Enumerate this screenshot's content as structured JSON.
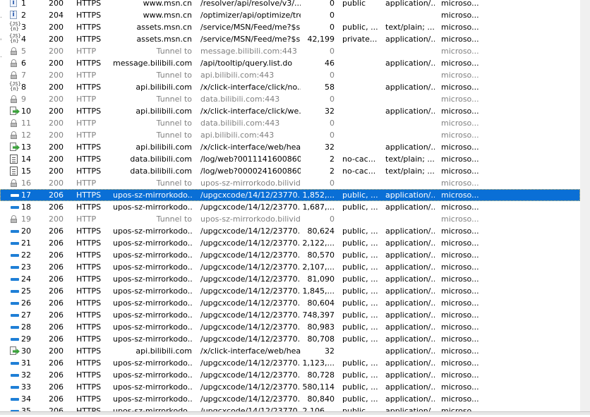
{
  "sessions": [
    {
      "icon": "info-icon",
      "num": "1",
      "result": "200",
      "protocol": "HTTPS",
      "host": "www.msn.cn",
      "url": "/resolver/api/resolve/v3/...",
      "body": "0",
      "caching": "public",
      "content_type": "application/...",
      "process": "microso...",
      "tunnel": false,
      "selected": false
    },
    {
      "icon": "info-icon",
      "num": "2",
      "result": "204",
      "protocol": "HTTPS",
      "host": "www.msn.cn",
      "url": "/optimizer/api/optimize/tre...",
      "body": "0",
      "caching": "",
      "content_type": "",
      "process": "microso...",
      "tunnel": false,
      "selected": false
    },
    {
      "icon": "js-icon",
      "num": "3",
      "result": "200",
      "protocol": "HTTPS",
      "host": "assets.msn.cn",
      "url": "/service/MSN/Feed/me?$s...",
      "body": "0",
      "caching": "public, ...",
      "content_type": "text/plain; ...",
      "process": "microso...",
      "tunnel": false,
      "selected": false
    },
    {
      "icon": "js-icon",
      "num": "4",
      "result": "200",
      "protocol": "HTTPS",
      "host": "assets.msn.cn",
      "url": "/service/MSN/Feed/me?$s...",
      "body": "42,199",
      "caching": "private...",
      "content_type": "application/...",
      "process": "microso...",
      "tunnel": false,
      "selected": false
    },
    {
      "icon": "lock-icon",
      "num": "5",
      "result": "200",
      "protocol": "HTTP",
      "host": "Tunnel to",
      "url": "message.bilibili.com:443",
      "body": "0",
      "caching": "",
      "content_type": "",
      "process": "microso...",
      "tunnel": true,
      "selected": false
    },
    {
      "icon": "lock-icon",
      "num": "6",
      "result": "200",
      "protocol": "HTTPS",
      "host": "message.bilibili.com",
      "url": "/api/tooltip/query.list.do",
      "body": "46",
      "caching": "",
      "content_type": "application/...",
      "process": "microso...",
      "tunnel": false,
      "selected": false
    },
    {
      "icon": "lock-icon",
      "num": "7",
      "result": "200",
      "protocol": "HTTP",
      "host": "Tunnel to",
      "url": "api.bilibili.com:443",
      "body": "0",
      "caching": "",
      "content_type": "",
      "process": "microso...",
      "tunnel": true,
      "selected": false
    },
    {
      "icon": "js-icon",
      "num": "8",
      "result": "200",
      "protocol": "HTTPS",
      "host": "api.bilibili.com",
      "url": "/x/click-interface/click/no...",
      "body": "58",
      "caching": "",
      "content_type": "application/...",
      "process": "microso...",
      "tunnel": false,
      "selected": false
    },
    {
      "icon": "lock-icon",
      "num": "9",
      "result": "200",
      "protocol": "HTTP",
      "host": "Tunnel to",
      "url": "data.bilibili.com:443",
      "body": "0",
      "caching": "",
      "content_type": "",
      "process": "microso...",
      "tunnel": true,
      "selected": false
    },
    {
      "icon": "arrow-icon",
      "num": "10",
      "result": "200",
      "protocol": "HTTPS",
      "host": "api.bilibili.com",
      "url": "/x/click-interface/click/we...",
      "body": "32",
      "caching": "",
      "content_type": "application/...",
      "process": "microso...",
      "tunnel": false,
      "selected": false
    },
    {
      "icon": "lock-icon",
      "num": "11",
      "result": "200",
      "protocol": "HTTP",
      "host": "Tunnel to",
      "url": "data.bilibili.com:443",
      "body": "0",
      "caching": "",
      "content_type": "",
      "process": "microso...",
      "tunnel": true,
      "selected": false
    },
    {
      "icon": "lock-icon",
      "num": "12",
      "result": "200",
      "protocol": "HTTP",
      "host": "Tunnel to",
      "url": "api.bilibili.com:443",
      "body": "0",
      "caching": "",
      "content_type": "",
      "process": "microso...",
      "tunnel": true,
      "selected": false
    },
    {
      "icon": "arrow-icon",
      "num": "13",
      "result": "200",
      "protocol": "HTTPS",
      "host": "api.bilibili.com",
      "url": "/x/click-interface/web/hea...",
      "body": "32",
      "caching": "",
      "content_type": "application/...",
      "process": "microso...",
      "tunnel": false,
      "selected": false
    },
    {
      "icon": "doc-icon",
      "num": "14",
      "result": "200",
      "protocol": "HTTPS",
      "host": "data.bilibili.com",
      "url": "/log/web?0011141600860...",
      "body": "2",
      "caching": "no-cac...",
      "content_type": "text/plain; ...",
      "process": "microso...",
      "tunnel": false,
      "selected": false
    },
    {
      "icon": "doc-icon",
      "num": "15",
      "result": "200",
      "protocol": "HTTPS",
      "host": "data.bilibili.com",
      "url": "/log/web?0000241600860...",
      "body": "2",
      "caching": "no-cac...",
      "content_type": "text/plain; ...",
      "process": "microso...",
      "tunnel": false,
      "selected": false
    },
    {
      "icon": "lock-icon",
      "num": "16",
      "result": "200",
      "protocol": "HTTP",
      "host": "Tunnel to",
      "url": "upos-sz-mirrorkodo.bilivid...",
      "body": "0",
      "caching": "",
      "content_type": "",
      "process": "microso...",
      "tunnel": true,
      "selected": false
    },
    {
      "icon": "stream-icon",
      "num": "17",
      "result": "206",
      "protocol": "HTTPS",
      "host": "upos-sz-mirrorkodo....",
      "url": "/upgcxcode/14/12/23770...",
      "body": "1,852,...",
      "caching": "public, ...",
      "content_type": "application/...",
      "process": "microso...",
      "tunnel": false,
      "selected": true
    },
    {
      "icon": "stream-icon",
      "num": "18",
      "result": "206",
      "protocol": "HTTPS",
      "host": "upos-sz-mirrorkodo....",
      "url": "/upgcxcode/14/12/23770...",
      "body": "1,687,...",
      "caching": "public, ...",
      "content_type": "application/...",
      "process": "microso...",
      "tunnel": false,
      "selected": false
    },
    {
      "icon": "lock-icon",
      "num": "19",
      "result": "200",
      "protocol": "HTTP",
      "host": "Tunnel to",
      "url": "upos-sz-mirrorkodo.bilivid...",
      "body": "0",
      "caching": "",
      "content_type": "",
      "process": "microso...",
      "tunnel": true,
      "selected": false
    },
    {
      "icon": "stream-icon",
      "num": "20",
      "result": "206",
      "protocol": "HTTPS",
      "host": "upos-sz-mirrorkodo....",
      "url": "/upgcxcode/14/12/23770...",
      "body": "80,624",
      "caching": "public, ...",
      "content_type": "application/...",
      "process": "microso...",
      "tunnel": false,
      "selected": false
    },
    {
      "icon": "stream-icon",
      "num": "21",
      "result": "206",
      "protocol": "HTTPS",
      "host": "upos-sz-mirrorkodo....",
      "url": "/upgcxcode/14/12/23770...",
      "body": "2,122,...",
      "caching": "public, ...",
      "content_type": "application/...",
      "process": "microso...",
      "tunnel": false,
      "selected": false
    },
    {
      "icon": "stream-icon",
      "num": "22",
      "result": "206",
      "protocol": "HTTPS",
      "host": "upos-sz-mirrorkodo....",
      "url": "/upgcxcode/14/12/23770...",
      "body": "80,570",
      "caching": "public, ...",
      "content_type": "application/...",
      "process": "microso...",
      "tunnel": false,
      "selected": false
    },
    {
      "icon": "stream-icon",
      "num": "23",
      "result": "206",
      "protocol": "HTTPS",
      "host": "upos-sz-mirrorkodo....",
      "url": "/upgcxcode/14/12/23770...",
      "body": "2,107,...",
      "caching": "public, ...",
      "content_type": "application/...",
      "process": "microso...",
      "tunnel": false,
      "selected": false
    },
    {
      "icon": "stream-icon",
      "num": "24",
      "result": "206",
      "protocol": "HTTPS",
      "host": "upos-sz-mirrorkodo....",
      "url": "/upgcxcode/14/12/23770...",
      "body": "81,090",
      "caching": "public, ...",
      "content_type": "application/...",
      "process": "microso...",
      "tunnel": false,
      "selected": false
    },
    {
      "icon": "stream-icon",
      "num": "25",
      "result": "206",
      "protocol": "HTTPS",
      "host": "upos-sz-mirrorkodo....",
      "url": "/upgcxcode/14/12/23770...",
      "body": "1,845,...",
      "caching": "public, ...",
      "content_type": "application/...",
      "process": "microso...",
      "tunnel": false,
      "selected": false
    },
    {
      "icon": "stream-icon",
      "num": "26",
      "result": "206",
      "protocol": "HTTPS",
      "host": "upos-sz-mirrorkodo....",
      "url": "/upgcxcode/14/12/23770...",
      "body": "80,604",
      "caching": "public, ...",
      "content_type": "application/...",
      "process": "microso...",
      "tunnel": false,
      "selected": false
    },
    {
      "icon": "stream-icon",
      "num": "27",
      "result": "206",
      "protocol": "HTTPS",
      "host": "upos-sz-mirrorkodo....",
      "url": "/upgcxcode/14/12/23770...",
      "body": "748,397",
      "caching": "public, ...",
      "content_type": "application/...",
      "process": "microso...",
      "tunnel": false,
      "selected": false
    },
    {
      "icon": "stream-icon",
      "num": "28",
      "result": "206",
      "protocol": "HTTPS",
      "host": "upos-sz-mirrorkodo....",
      "url": "/upgcxcode/14/12/23770...",
      "body": "80,983",
      "caching": "public, ...",
      "content_type": "application/...",
      "process": "microso...",
      "tunnel": false,
      "selected": false
    },
    {
      "icon": "stream-icon",
      "num": "29",
      "result": "206",
      "protocol": "HTTPS",
      "host": "upos-sz-mirrorkodo....",
      "url": "/upgcxcode/14/12/23770...",
      "body": "80,708",
      "caching": "public, ...",
      "content_type": "application/...",
      "process": "microso...",
      "tunnel": false,
      "selected": false
    },
    {
      "icon": "arrow-icon",
      "num": "30",
      "result": "200",
      "protocol": "HTTPS",
      "host": "api.bilibili.com",
      "url": "/x/click-interface/web/hea...",
      "body": "32",
      "caching": "",
      "content_type": "application/...",
      "process": "microso...",
      "tunnel": false,
      "selected": false
    },
    {
      "icon": "stream-icon",
      "num": "31",
      "result": "206",
      "protocol": "HTTPS",
      "host": "upos-sz-mirrorkodo....",
      "url": "/upgcxcode/14/12/23770...",
      "body": "1,123,...",
      "caching": "public, ...",
      "content_type": "application/...",
      "process": "microso...",
      "tunnel": false,
      "selected": false
    },
    {
      "icon": "stream-icon",
      "num": "32",
      "result": "206",
      "protocol": "HTTPS",
      "host": "upos-sz-mirrorkodo....",
      "url": "/upgcxcode/14/12/23770...",
      "body": "80,728",
      "caching": "public, ...",
      "content_type": "application/...",
      "process": "microso...",
      "tunnel": false,
      "selected": false
    },
    {
      "icon": "stream-icon",
      "num": "33",
      "result": "206",
      "protocol": "HTTPS",
      "host": "upos-sz-mirrorkodo....",
      "url": "/upgcxcode/14/12/23770...",
      "body": "580,114",
      "caching": "public, ...",
      "content_type": "application/...",
      "process": "microso...",
      "tunnel": false,
      "selected": false
    },
    {
      "icon": "stream-icon",
      "num": "34",
      "result": "206",
      "protocol": "HTTPS",
      "host": "upos-sz-mirrorkodo....",
      "url": "/upgcxcode/14/12/23770...",
      "body": "80,840",
      "caching": "public, ...",
      "content_type": "application/...",
      "process": "microso...",
      "tunnel": false,
      "selected": false
    },
    {
      "icon": "stream-icon",
      "num": "35",
      "result": "206",
      "protocol": "HTTPS",
      "host": "upos-sz-mirrorkodo....",
      "url": "/upgcxcode/14/12/23770...",
      "body": "2,106,...",
      "caching": "public, ...",
      "content_type": "application/...",
      "process": "microso...",
      "tunnel": false,
      "selected": false
    }
  ]
}
